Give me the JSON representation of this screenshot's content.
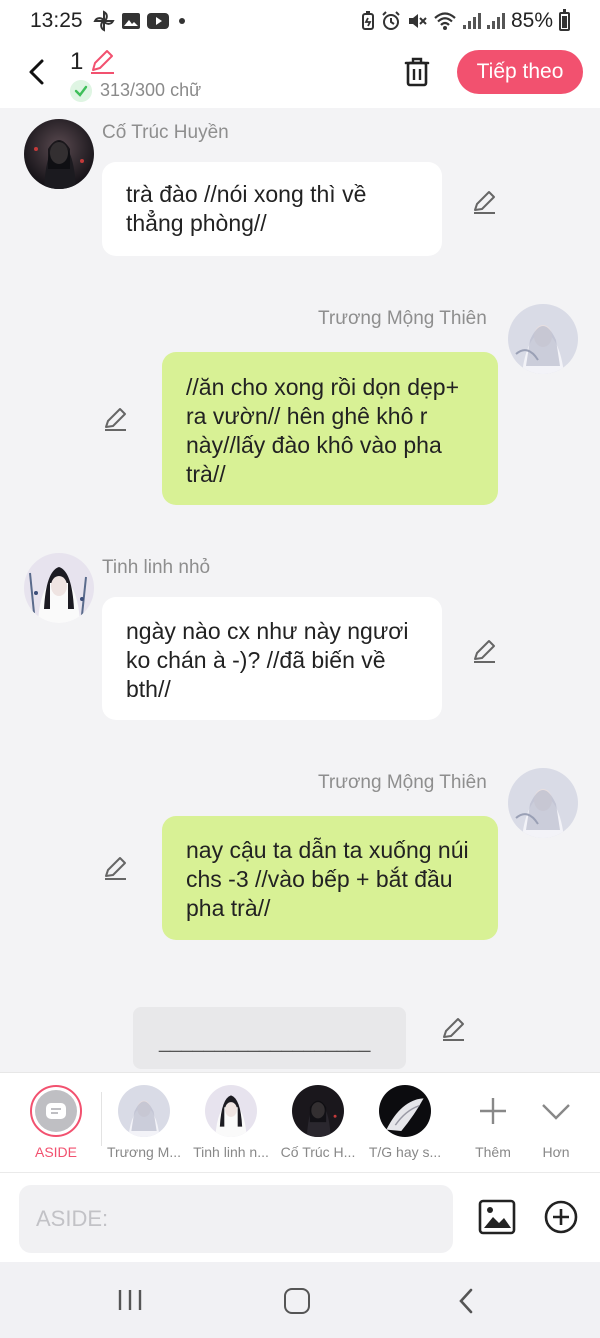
{
  "status_bar": {
    "time": "13:25",
    "battery": "85%"
  },
  "header": {
    "draft_number": "1",
    "word_count": "313/300 chữ",
    "next_button": "Tiếp theo"
  },
  "messages": [
    {
      "side": "left",
      "name": "Cố Trúc Huyền",
      "text": "trà đào //nói xong thì về thẳng phòng//",
      "bubble": "white"
    },
    {
      "side": "right",
      "name": "Trương Mộng Thiên",
      "text": "//ăn cho xong rồi dọn dẹp+ ra vườn// hên ghê khô r này//lấy đào khô vào pha trà//",
      "bubble": "green"
    },
    {
      "side": "left",
      "name": "Tinh linh nhỏ",
      "text": "ngày nào cx như này ngươi ko chán à -)? //đã biến về bth//",
      "bubble": "white"
    },
    {
      "side": "right",
      "name": "Trương Mộng Thiên",
      "text": "nay cậu ta dẫn ta xuống núi chs -3 //vào bếp + bắt đầu pha trà//",
      "bubble": "green"
    }
  ],
  "aside_draft": "___________________",
  "character_bar": [
    {
      "label": "ASIDE"
    },
    {
      "label": "Trương M..."
    },
    {
      "label": "Tinh linh n..."
    },
    {
      "label": "Cố Trúc H..."
    },
    {
      "label": "T/G hay s..."
    },
    {
      "label": "Thêm"
    },
    {
      "label": "Hơn"
    }
  ],
  "input": {
    "placeholder": "ASIDE:"
  },
  "colors": {
    "accent": "#f2516f",
    "green_bubble": "#d8f195",
    "white_bubble": "#ffffff",
    "background": "#f3f3f5"
  }
}
